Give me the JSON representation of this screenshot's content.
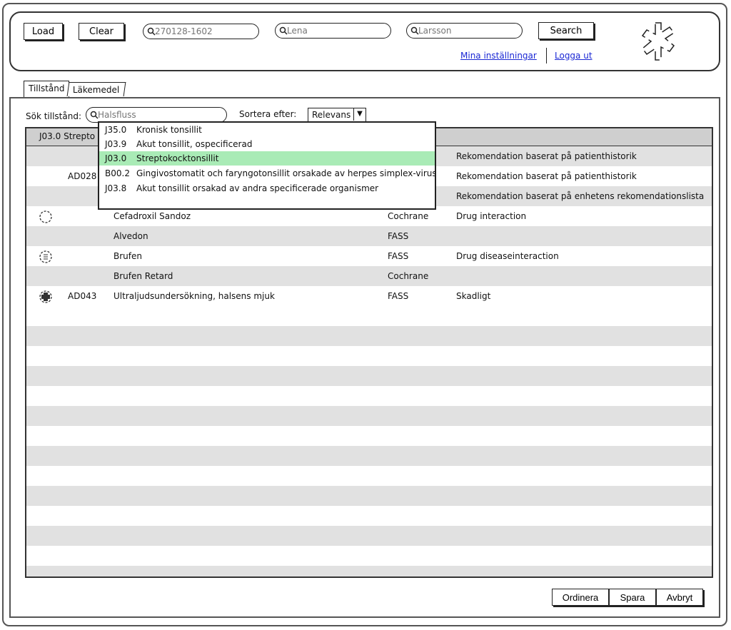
{
  "toolbar": {
    "load_label": "Load",
    "clear_label": "Clear",
    "search_label": "Search",
    "pnr_placeholder": "270128-1602",
    "firstname_placeholder": "Lena",
    "lastname_placeholder": "Larsson",
    "settings_link": "Mina inställningar",
    "logout_link": "Logga ut"
  },
  "tabs": [
    {
      "label": "Tillstånd",
      "active": true
    },
    {
      "label": "Läkemedel",
      "active": false
    }
  ],
  "filter": {
    "search_label": "Sök tillstånd:",
    "search_placeholder": "Halsfluss",
    "sort_label": "Sortera efter:",
    "sort_value": "Relevans"
  },
  "group_header": "J03.0 Strepto",
  "dropdown": {
    "items": [
      {
        "code": "J35.0",
        "text": "Kronisk tonsillit"
      },
      {
        "code": "J03.9",
        "text": "Akut tonsillit, ospecificerad"
      },
      {
        "code": "J03.0",
        "text": "Streptokocktonsillit",
        "selected": true
      },
      {
        "code": "B00.2",
        "text": "Gingivostomatit och faryngotonsillit orsakade av herpes simplex-virus"
      },
      {
        "code": "J03.8",
        "text": "Akut tonsillit orsakad av andra specificerade organismer"
      }
    ]
  },
  "rows": [
    {
      "icon": "",
      "code": "",
      "name": "",
      "source": "",
      "note": "Rekomendation baserat på patienthistorik"
    },
    {
      "icon": "",
      "code": "AD028",
      "name": "",
      "source": "",
      "note": "Rekomendation baserat på patienthistorik"
    },
    {
      "icon": "",
      "code": "",
      "name": "",
      "source": "",
      "note": "Rekomendation baserat på enhetens rekomendationslista"
    },
    {
      "icon": "warning-dashed-icon",
      "code": "",
      "name": "Cefadroxil Sandoz",
      "source": "Cochrane",
      "note": "Drug interaction"
    },
    {
      "icon": "",
      "code": "",
      "name": "Alvedon",
      "source": "FASS",
      "note": ""
    },
    {
      "icon": "caution-dashed-icon",
      "code": "",
      "name": "Brufen",
      "source": "FASS",
      "note": "Drug diseaseinteraction"
    },
    {
      "icon": "",
      "code": "",
      "name": "Brufen Retard",
      "source": "Cochrane",
      "note": ""
    },
    {
      "icon": "danger-icon",
      "code": "AD043",
      "name": "Ultraljudsundersökning, halsens mjuk",
      "source": "FASS",
      "note": "Skadligt"
    }
  ],
  "footer": {
    "order_label": "Ordinera",
    "save_label": "Spara",
    "cancel_label": "Avbryt"
  },
  "colors": {
    "link": "#1a27d4",
    "selected_item": "#a9ebb6",
    "row_alt": "#e1e1e1",
    "header_bg": "#cfcfcf"
  }
}
